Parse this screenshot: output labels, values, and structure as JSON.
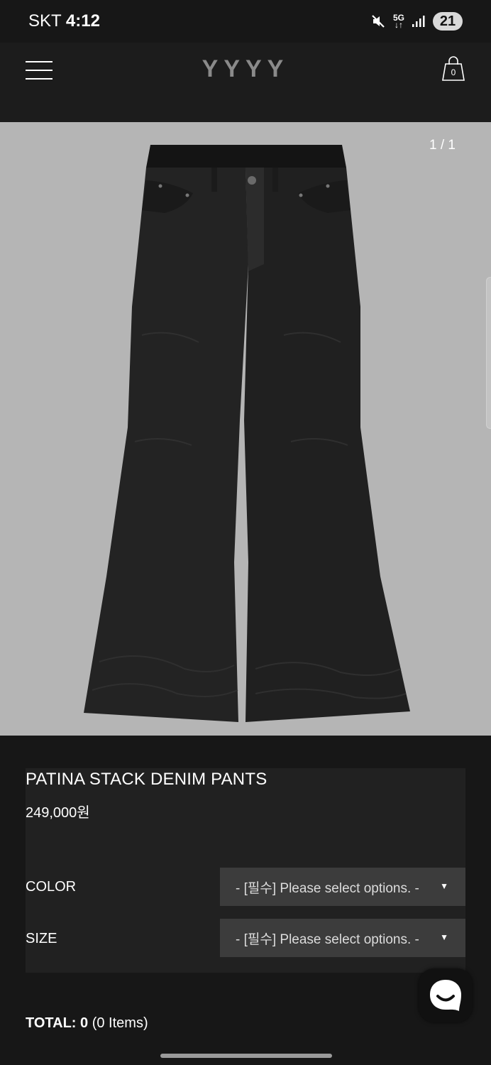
{
  "status_bar": {
    "carrier": "SKT",
    "time": "4:12",
    "network": "5G",
    "battery": "21"
  },
  "header": {
    "logo": "YYYY",
    "cart_count": "0"
  },
  "gallery": {
    "pager": "1 / 1",
    "image_icon": "flared-black-denim-pants"
  },
  "product": {
    "name": "PATINA STACK DENIM PANTS",
    "price": "249,000원"
  },
  "options": [
    {
      "label": "COLOR",
      "placeholder": "- [필수] Please select options. -"
    },
    {
      "label": "SIZE",
      "placeholder": "- [필수] Please select options. -"
    }
  ],
  "total": {
    "label": "TOTAL:",
    "amount": "0",
    "items": "(0 Items)"
  },
  "colors": {
    "background": "#171717",
    "gallery_bg": "#b5b5b5",
    "select_bg": "#3c3c3c",
    "logo": "#8a8a8a"
  }
}
